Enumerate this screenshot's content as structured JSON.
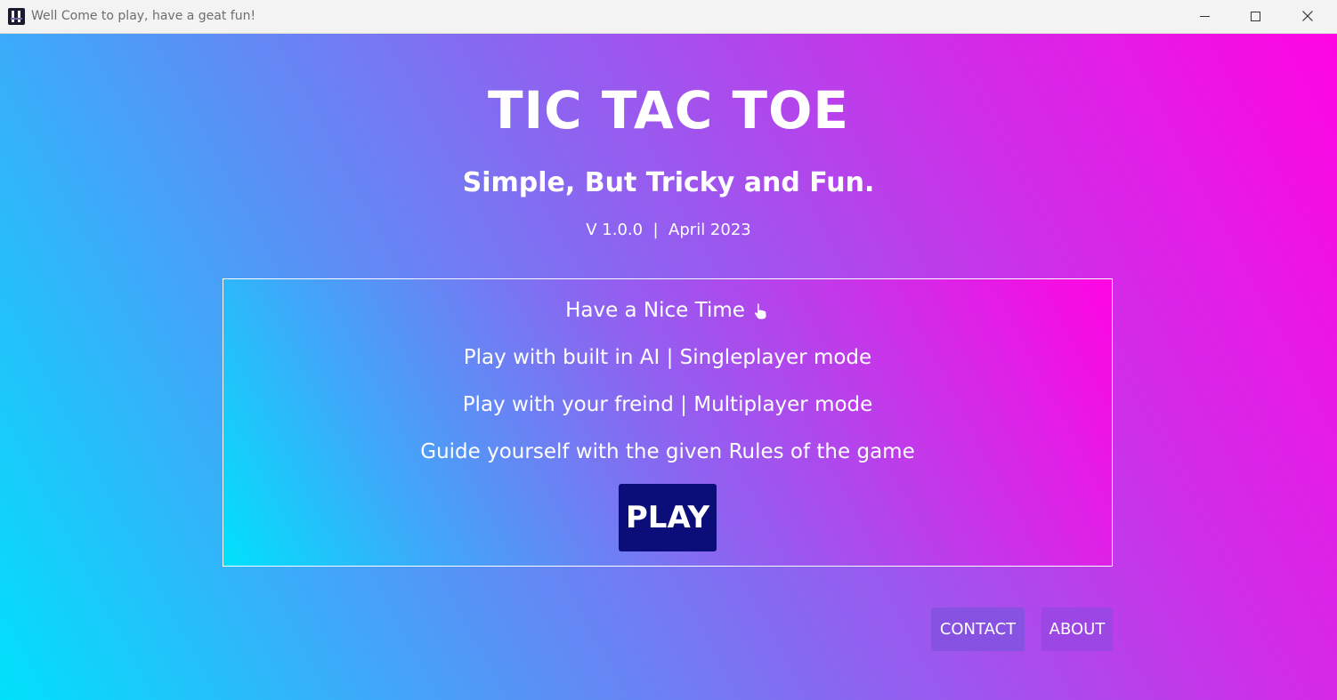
{
  "window": {
    "title": "Well Come to play, have a geat fun!"
  },
  "main": {
    "title": "TIC TAC TOE",
    "subtitle": "Simple, But Tricky and Fun.",
    "version": "V 1.0.0  |  April 2023"
  },
  "panel": {
    "lines": [
      "Have a Nice Time",
      "Play with built in AI | Singleplayer mode",
      "Play with your freind | Multiplayer mode",
      "Guide yourself with the given Rules of the game"
    ],
    "hand_icon": "pointing-hand-icon",
    "play_label": "PLAY"
  },
  "footer": {
    "contact_label": "CONTACT",
    "about_label": "ABOUT"
  },
  "colors": {
    "gradient_start": "#00e1fb",
    "gradient_end": "#ff05e3",
    "play_button": "#0b0e78",
    "text": "#ffffff"
  }
}
